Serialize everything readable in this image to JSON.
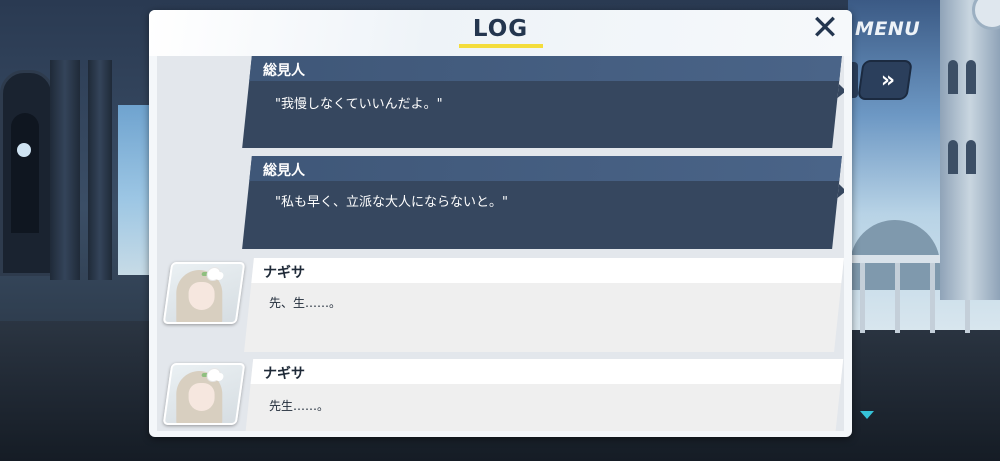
{
  "header": {
    "title": "LOG",
    "close_icon": "close-icon"
  },
  "hud": {
    "menu_label": "MENU",
    "fast_forward_label": "»"
  },
  "log_entries": [
    {
      "speaker": "総見人",
      "text": "\"我慢しなくていいんだよ。\"",
      "style": "protagonist"
    },
    {
      "speaker": "総見人",
      "text": "\"私も早く、立派な大人にならないと。\"",
      "style": "protagonist"
    },
    {
      "speaker": "ナギサ",
      "text": "先、生……。",
      "style": "character",
      "avatar": "nagisa-avatar"
    },
    {
      "speaker": "ナギサ",
      "text": "先生……。",
      "style": "character",
      "avatar": "nagisa-avatar"
    }
  ],
  "colors": {
    "panel_bg": "#f4f7fa",
    "title_underline": "#f4dd3c",
    "protagonist_bubble": "#36475f",
    "character_bubble": "#efefef",
    "scroll_indicator": "#36c3d8"
  }
}
